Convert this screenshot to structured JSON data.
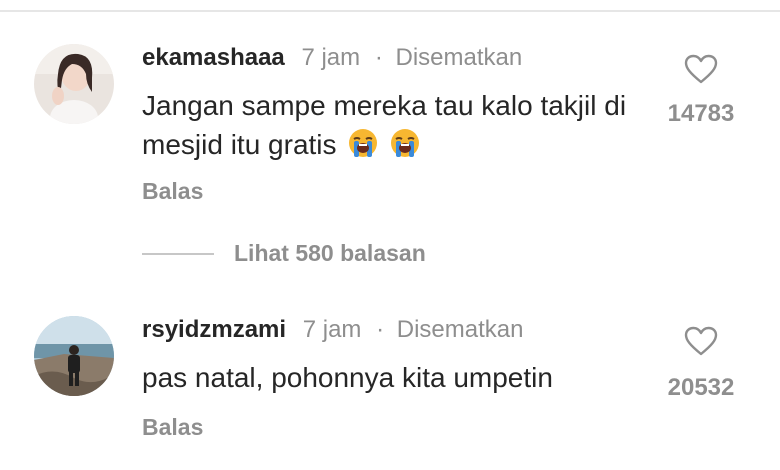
{
  "comments": [
    {
      "username": "ekamashaaa",
      "time": "7 jam",
      "separator": "·",
      "pinned": "Disematkan",
      "text": "Jangan sampe mereka tau kalo takjil di mesjid itu gratis",
      "emojis": [
        "loudly-crying-face-emoji",
        "loudly-crying-face-emoji"
      ],
      "reply_label": "Balas",
      "likes": "14783",
      "view_replies": "Lihat 580 balasan"
    },
    {
      "username": "rsyidzmzami",
      "time": "7 jam",
      "separator": "·",
      "pinned": "Disematkan",
      "text": "pas natal, pohonnya kita umpetin",
      "reply_label": "Balas",
      "likes": "20532"
    }
  ],
  "colors": {
    "primary_text": "#262626",
    "secondary_text": "#8e8e8e",
    "divider": "#e6e6e6"
  }
}
